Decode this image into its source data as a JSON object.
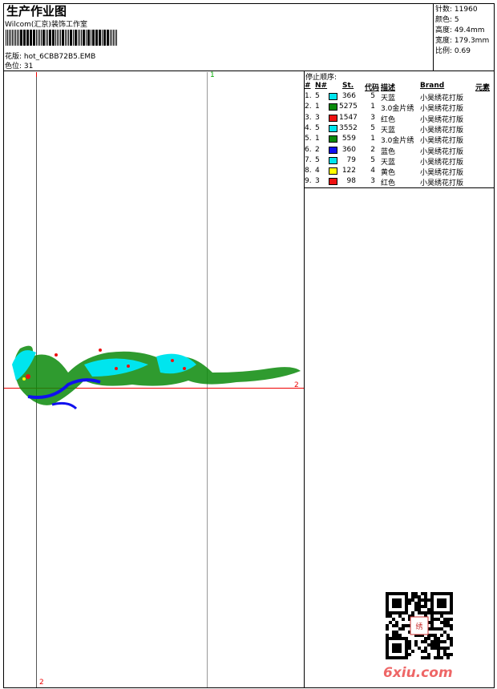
{
  "header": {
    "title": "生产作业图",
    "studio": "Wilcom(汇京)装饰工作室",
    "design_label": "花版:",
    "design_value": "hot_6CBB72B5.EMB",
    "color_pos_label": "色位:",
    "color_pos_value": "31"
  },
  "stats": [
    {
      "label": "针数:",
      "value": "11960"
    },
    {
      "label": "颜色:",
      "value": "5"
    },
    {
      "label": "高度:",
      "value": "49.4mm"
    },
    {
      "label": "宽度:",
      "value": "179.3mm"
    },
    {
      "label": "比例:",
      "value": "0.69"
    }
  ],
  "stop_sequence": {
    "caption": "停止顺序:",
    "columns": [
      "#",
      "N#",
      "St.",
      "代码",
      "描述",
      "Brand",
      "元素"
    ],
    "rows": [
      {
        "idx": "1.",
        "n": "5",
        "color": "#00e5ee",
        "st": "366",
        "code": "5",
        "desc": "天蓝",
        "brand": "小昊绣花打版"
      },
      {
        "idx": "2.",
        "n": "1",
        "color": "#0a8a0a",
        "st": "5275",
        "code": "1",
        "desc": "3.0金片绣",
        "brand": "小昊绣花打版"
      },
      {
        "idx": "3.",
        "n": "3",
        "color": "#ee1111",
        "st": "1547",
        "code": "3",
        "desc": "红色",
        "brand": "小昊绣花打版"
      },
      {
        "idx": "4.",
        "n": "5",
        "color": "#00e5ee",
        "st": "3552",
        "code": "5",
        "desc": "天蓝",
        "brand": "小昊绣花打版"
      },
      {
        "idx": "5.",
        "n": "1",
        "color": "#0a8a0a",
        "st": "559",
        "code": "1",
        "desc": "3.0金片绣",
        "brand": "小昊绣花打版"
      },
      {
        "idx": "6.",
        "n": "2",
        "color": "#1010ee",
        "st": "360",
        "code": "2",
        "desc": "蓝色",
        "brand": "小昊绣花打版"
      },
      {
        "idx": "7.",
        "n": "5",
        "color": "#00e5ee",
        "st": "79",
        "code": "5",
        "desc": "天蓝",
        "brand": "小昊绣花打版"
      },
      {
        "idx": "8.",
        "n": "4",
        "color": "#ffff00",
        "st": "122",
        "code": "4",
        "desc": "黄色",
        "brand": "小昊绣花打版"
      },
      {
        "idx": "9.",
        "n": "3",
        "color": "#ee1111",
        "st": "98",
        "code": "3",
        "desc": "红色",
        "brand": "小昊绣花打版"
      }
    ]
  },
  "canvas": {
    "marker_top": "1",
    "marker_bottom": "2",
    "marker_right": "2"
  },
  "watermark": "6xiu.com"
}
